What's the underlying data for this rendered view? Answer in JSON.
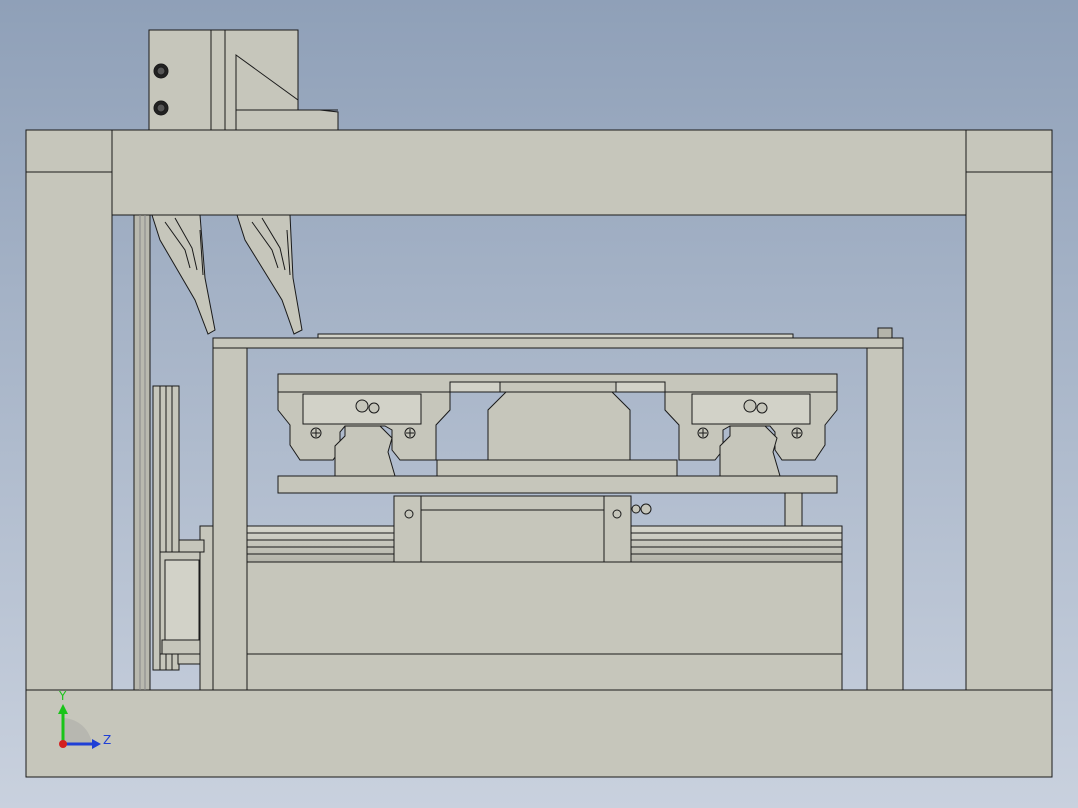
{
  "view": {
    "background_top": "#8fa0b8",
    "background_bottom": "#c9d1de",
    "part_fill": "#c6c6bb",
    "part_fill_light": "#d2d2c8",
    "edge_color": "#1a1a1a"
  },
  "triad": {
    "y_label": "Y",
    "z_label": "Z",
    "y_color": "#19c419",
    "z_color": "#1f3fd6",
    "x_color": "#d42020",
    "icon": "coordinate-triad-icon"
  }
}
